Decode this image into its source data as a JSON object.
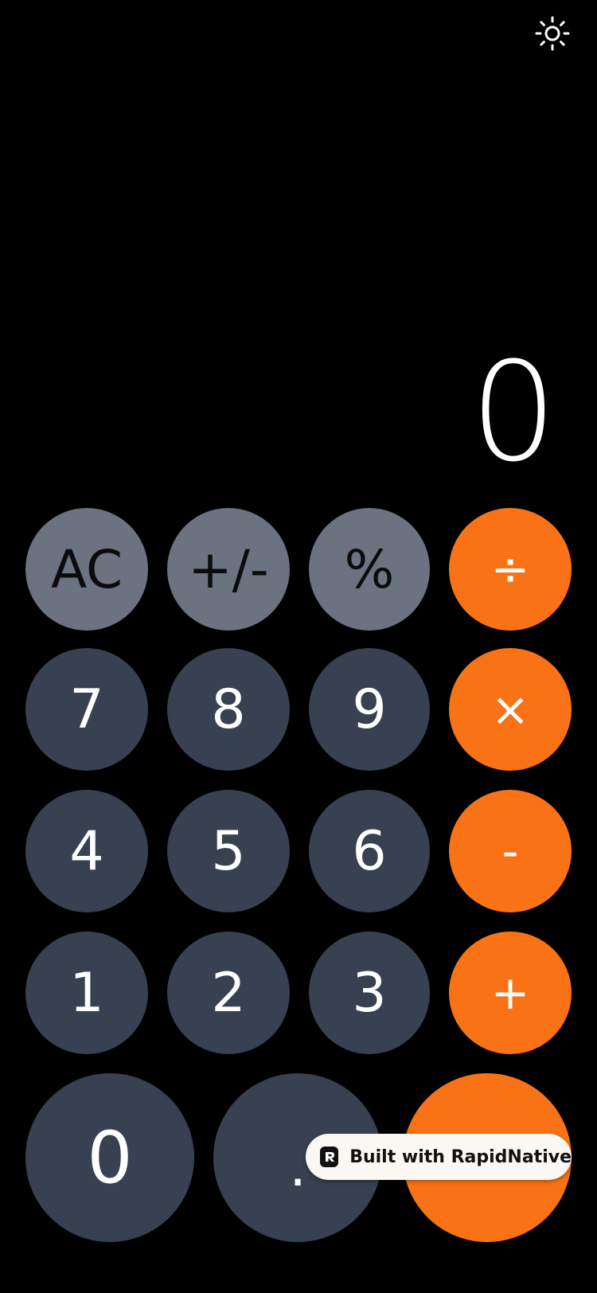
{
  "header": {
    "theme_icon": "sun-icon"
  },
  "display": {
    "value": "0"
  },
  "keypad": {
    "row1": [
      "AC",
      "+/-",
      "%",
      "÷"
    ],
    "row2": [
      "7",
      "8",
      "9",
      "×"
    ],
    "row3": [
      "4",
      "5",
      "6",
      "-"
    ],
    "row4": [
      "1",
      "2",
      "3",
      "+"
    ],
    "row5": [
      "0",
      ".",
      ""
    ]
  },
  "badge": {
    "label": "Built with RapidNative",
    "icon": "rapidnative-logo-icon"
  },
  "colors": {
    "background": "#000000",
    "function_key": "#6b7280",
    "number_key": "#374151",
    "operator_key": "#f97316",
    "text": "#ffffff",
    "function_text": "#0b0b0b"
  }
}
